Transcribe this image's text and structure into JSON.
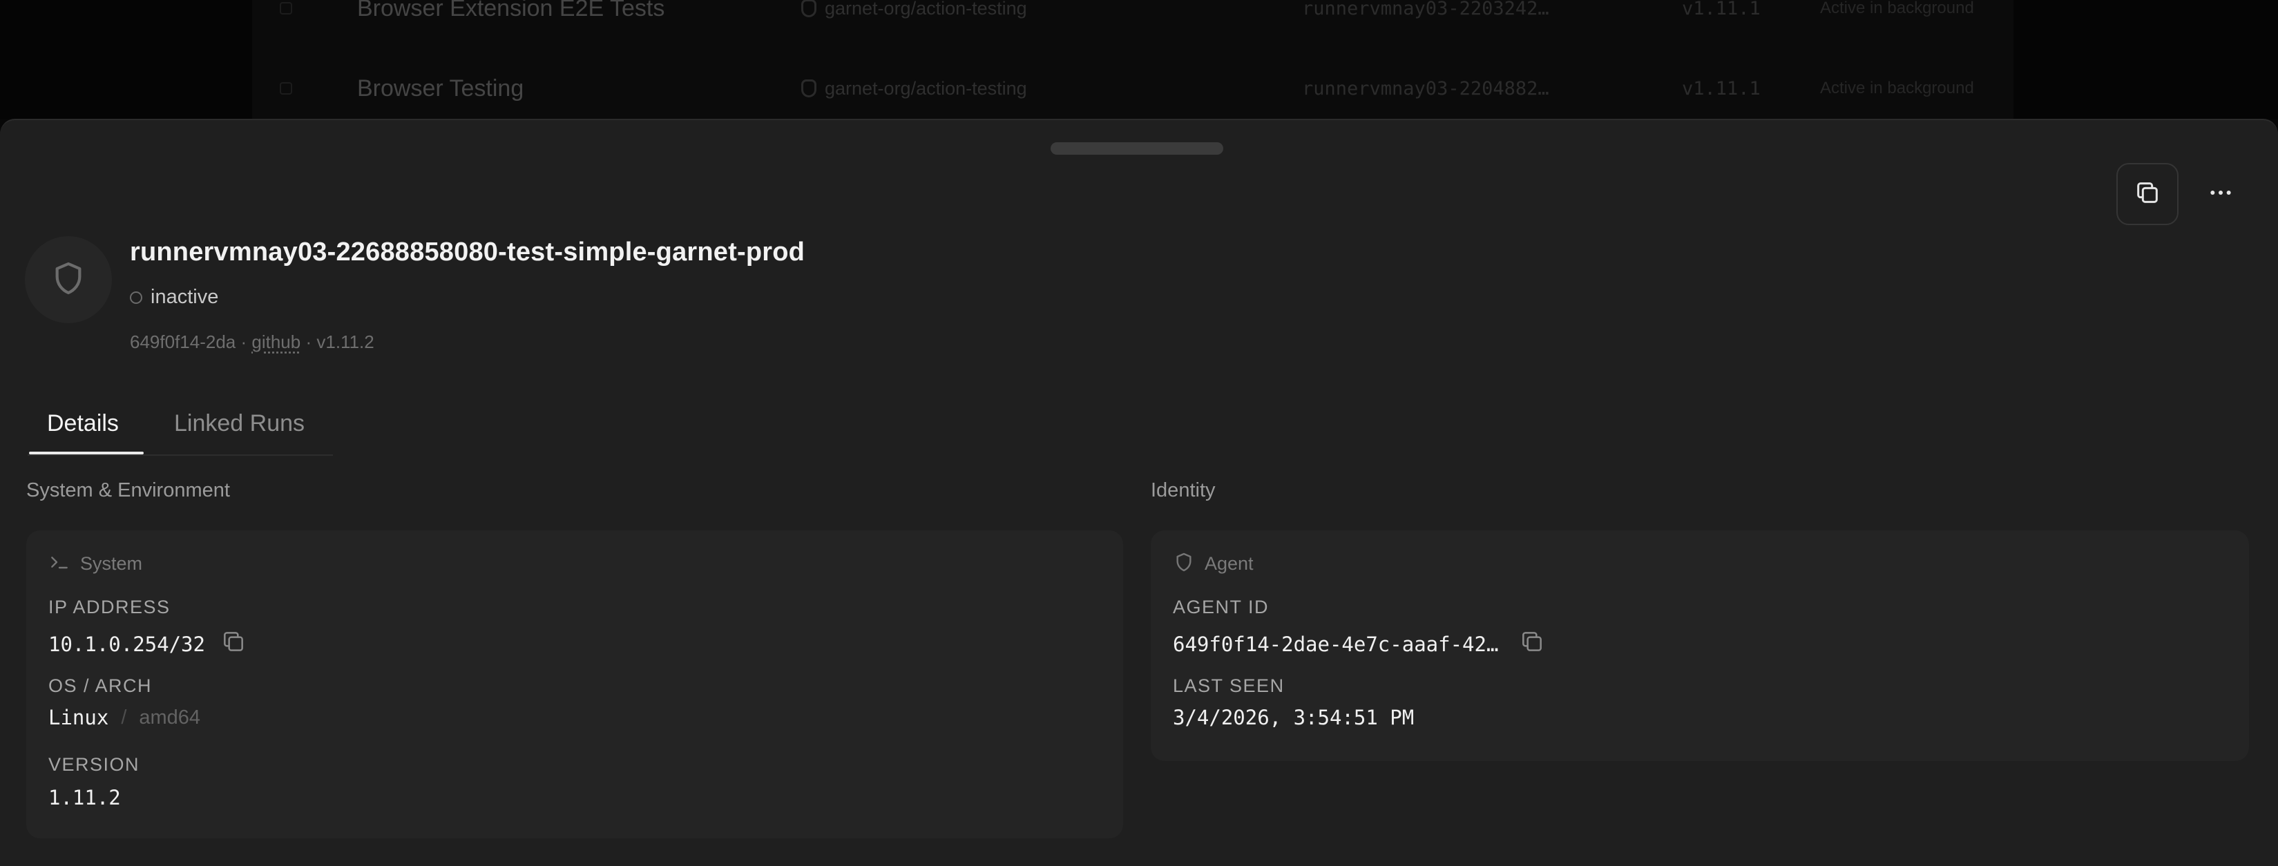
{
  "background_list": {
    "rows": [
      {
        "name": "Browser Extension E2E Tests",
        "repo": "garnet-org/action-testing",
        "runner": "runnervmnay03-2203242…",
        "version": "v1.11.1",
        "status": "Active in background"
      },
      {
        "name": "Browser Testing",
        "repo": "garnet-org/action-testing",
        "runner": "runnervmnay03-2204882…",
        "version": "v1.11.1",
        "status": "Active in background"
      }
    ]
  },
  "header": {
    "title": "runnervmnay03-22688858080-test-simple-garnet-prod",
    "status": "inactive",
    "meta_id": "649f0f14-2da",
    "meta_sep": "·",
    "meta_provider": "github",
    "meta_version": "v1.11.2"
  },
  "tabs": [
    {
      "label": "Details",
      "active": true
    },
    {
      "label": "Linked Runs",
      "active": false
    }
  ],
  "sections": {
    "system_env": {
      "title": "System & Environment",
      "card_title": "System",
      "ip_label": "IP ADDRESS",
      "ip_value": "10.1.0.254/32",
      "os_label": "OS / ARCH",
      "os_value": "Linux",
      "os_sep": "/",
      "arch_value": "amd64",
      "version_label": "VERSION",
      "version_value": "1.11.2"
    },
    "identity": {
      "title": "Identity",
      "card_title": "Agent",
      "agent_id_label": "AGENT ID",
      "agent_id_value": "649f0f14-2dae-4e7c-aaaf-42…",
      "last_seen_label": "LAST SEEN",
      "last_seen_value": "3/4/2026, 3:54:51 PM"
    }
  },
  "icons": {
    "copy": "copy-icon",
    "more": "more-horizontal-icon",
    "shield": "shield-icon",
    "terminal": "terminal-icon"
  },
  "colors": {
    "sheet_bg": "#1f1f1f",
    "card_bg": "#242424",
    "text_primary": "#f2f2f2",
    "text_muted": "#8e8e8e"
  }
}
